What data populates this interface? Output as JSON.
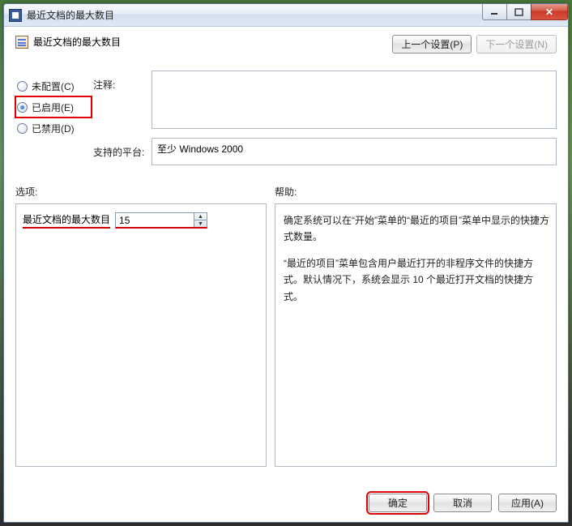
{
  "window": {
    "title": "最近文档的最大数目"
  },
  "header": {
    "title": "最近文档的最大数目",
    "prev_btn": "上一个设置(P)",
    "next_btn": "下一个设置(N)"
  },
  "radios": {
    "not_configured": "未配置(C)",
    "enabled": "已启用(E)",
    "disabled": "已禁用(D)",
    "selected": "enabled"
  },
  "labels": {
    "comment": "注释:",
    "platform": "支持的平台:",
    "options": "选项:",
    "help": "帮助:"
  },
  "fields": {
    "comment_value": "",
    "platform_value": "至少 Windows 2000"
  },
  "options": {
    "spinner_label": "最近文档的最大数目",
    "spinner_value": "15"
  },
  "help": {
    "p1": "确定系统可以在“开始”菜单的“最近的项目”菜单中显示的快捷方式数量。",
    "p2": "“最近的项目”菜单包含用户最近打开的非程序文件的快捷方式。默认情况下，系统会显示 10 个最近打开文档的快捷方式。"
  },
  "footer": {
    "ok": "确定",
    "cancel": "取消",
    "apply": "应用(A)"
  }
}
